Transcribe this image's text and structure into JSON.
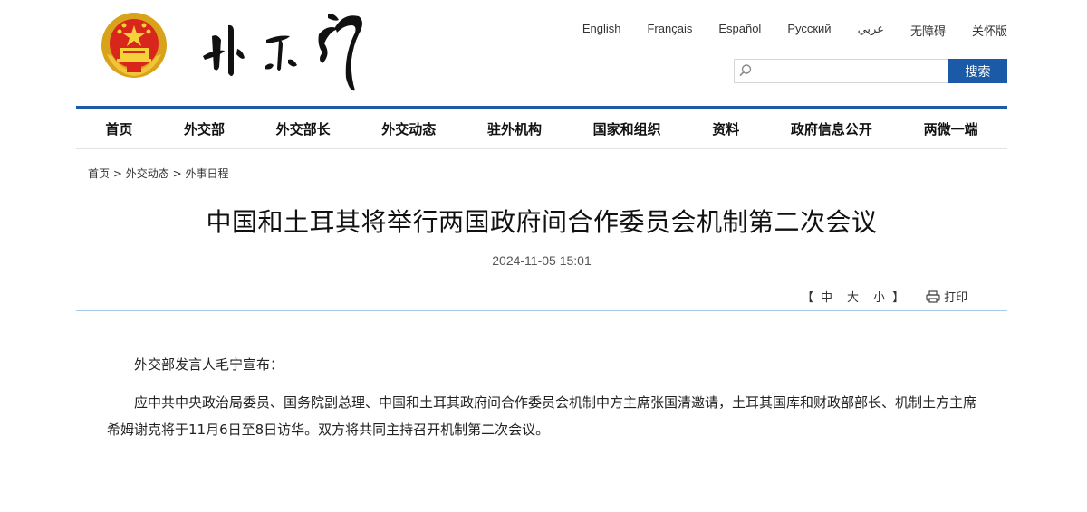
{
  "header": {
    "languages": [
      {
        "label": "English"
      },
      {
        "label": "Français"
      },
      {
        "label": "Español"
      },
      {
        "label": "Русский"
      },
      {
        "label": "عربي"
      },
      {
        "label": "无障碍"
      },
      {
        "label": "关怀版"
      }
    ],
    "search": {
      "placeholder": "",
      "button_label": "搜索"
    }
  },
  "nav": {
    "items": [
      {
        "label": "首页"
      },
      {
        "label": "外交部"
      },
      {
        "label": "外交部长"
      },
      {
        "label": "外交动态"
      },
      {
        "label": "驻外机构"
      },
      {
        "label": "国家和组织"
      },
      {
        "label": "资料"
      },
      {
        "label": "政府信息公开"
      },
      {
        "label": "两微一端"
      }
    ]
  },
  "breadcrumb": {
    "items": [
      {
        "label": "首页"
      },
      {
        "label": "外交动态"
      },
      {
        "label": "外事日程"
      }
    ],
    "separator": ">"
  },
  "article": {
    "title": "中国和土耳其将举行两国政府间合作委员会机制第二次会议",
    "datetime": "2024-11-05 15:01",
    "font_tools": {
      "open_bracket": "【",
      "close_bracket": "】",
      "sizes": [
        "中",
        "大",
        "小"
      ],
      "print_label": "打印"
    },
    "paragraphs": [
      "外交部发言人毛宁宣布：",
      "应中共中央政治局委员、国务院副总理、中国和土耳其政府间合作委员会机制中方主席张国清邀请，土耳其国库和财政部部长、机制土方主席希姆谢克将于11月6日至8日访华。双方将共同主持召开机制第二次会议。"
    ]
  },
  "colors": {
    "accent": "#1a5aa6",
    "divider": "#a9c9e6"
  },
  "icons": {
    "emblem": "national-emblem-icon",
    "calligraphy": "ministry-calligraphy-logo",
    "search": "search-icon",
    "print": "printer-icon"
  }
}
